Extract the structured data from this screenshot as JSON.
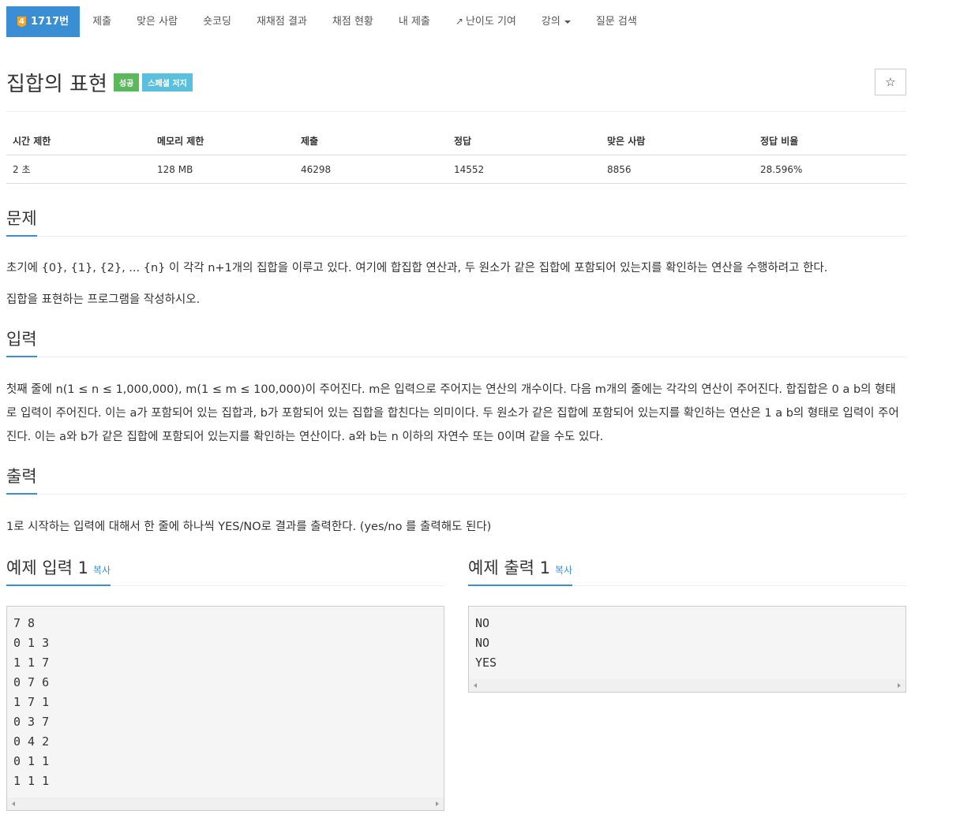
{
  "nav": {
    "problem": {
      "tier": "4",
      "label": "1717번"
    },
    "items": [
      "제출",
      "맞은 사람",
      "숏코딩",
      "재채점 결과",
      "채점 현황",
      "내 제출"
    ],
    "difficulty": "난이도 기여",
    "lecture": "강의",
    "search": "질문 검색"
  },
  "problem": {
    "title": "집합의 표현",
    "labels": [
      "성공",
      "스페셜 저지"
    ],
    "star": "☆"
  },
  "info": {
    "headers": [
      "시간 제한",
      "메모리 제한",
      "제출",
      "정답",
      "맞은 사람",
      "정답 비율"
    ],
    "values": [
      "2 초",
      "128 MB",
      "46298",
      "14552",
      "8856",
      "28.596%"
    ]
  },
  "sections": {
    "problem_title": "문제",
    "problem_p1": "초기에 {0}, {1}, {2}, ... {n} 이 각각 n+1개의 집합을 이루고 있다. 여기에 합집합 연산과, 두 원소가 같은 집합에 포함되어 있는지를 확인하는 연산을 수행하려고 한다.",
    "problem_p2": "집합을 표현하는 프로그램을 작성하시오.",
    "input_title": "입력",
    "input_text": "첫째 줄에 n(1 ≤ n ≤ 1,000,000), m(1 ≤ m ≤ 100,000)이 주어진다. m은 입력으로 주어지는 연산의 개수이다. 다음 m개의 줄에는 각각의 연산이 주어진다. 합집합은 0 a b의 형태로 입력이 주어진다. 이는 a가 포함되어 있는 집합과, b가 포함되어 있는 집합을 합친다는 의미이다. 두 원소가 같은 집합에 포함되어 있는지를 확인하는 연산은 1 a b의 형태로 입력이 주어진다. 이는 a와 b가 같은 집합에 포함되어 있는지를 확인하는 연산이다. a와 b는 n 이하의 자연수 또는 0이며 같을 수도 있다.",
    "output_title": "출력",
    "output_text": "1로 시작하는 입력에 대해서 한 줄에 하나씩 YES/NO로 결과를 출력한다. (yes/no 를 출력해도 된다)"
  },
  "samples": {
    "input_title": "예제 입력 1",
    "output_title": "예제 출력 1",
    "copy": "복사",
    "input": "7 8\n0 1 3\n1 1 7\n0 7 6\n1 7 1\n0 3 7\n0 4 2\n0 1 1\n1 1 1",
    "output": "NO\nNO\nYES"
  }
}
